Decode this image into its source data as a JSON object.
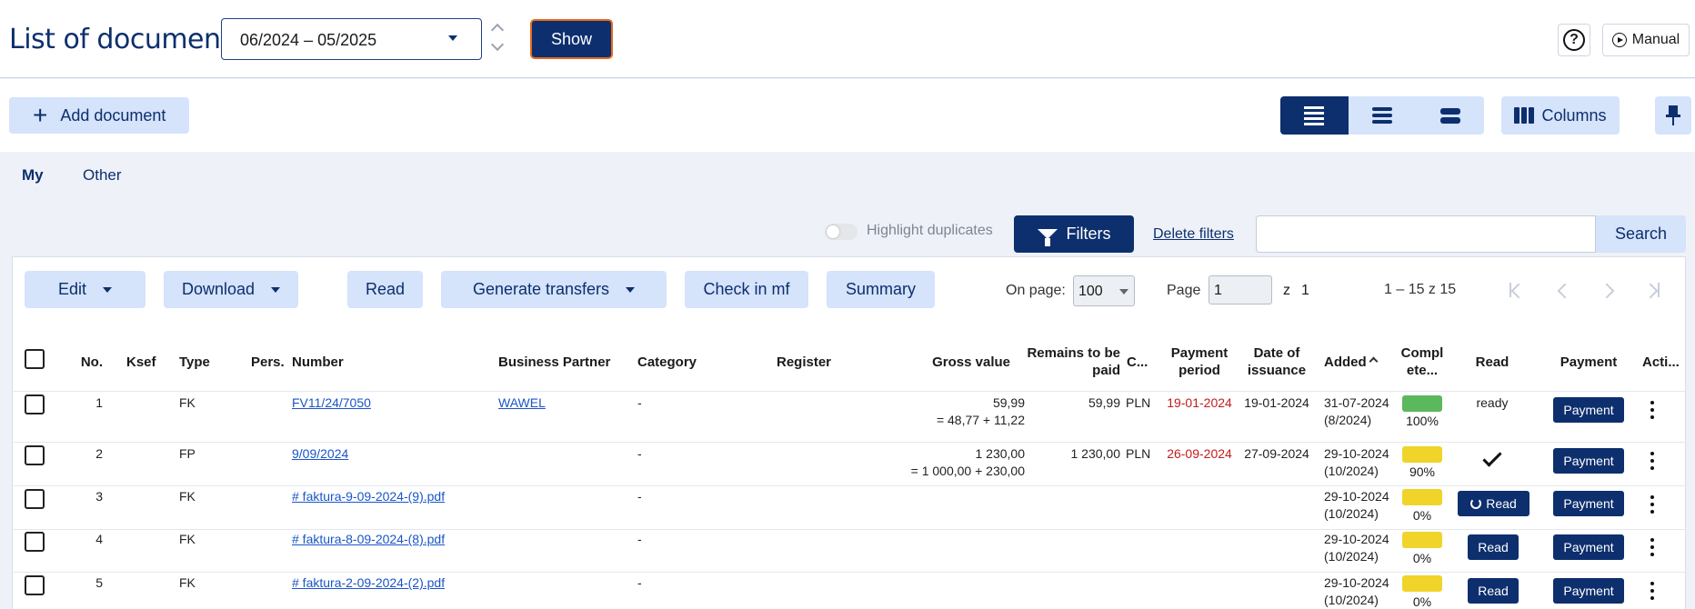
{
  "header": {
    "title": "List of documents",
    "period_value": "06/2024 – 05/2025",
    "show_label": "Show",
    "manual_label": "Manual"
  },
  "toolbar": {
    "add_document_label": "Add document",
    "columns_label": "Columns"
  },
  "tabs": [
    {
      "label": "My",
      "active": true
    },
    {
      "label": "Other",
      "active": false
    }
  ],
  "filters": {
    "highlight_duplicates_label": "Highlight duplicates",
    "highlight_duplicates_on": false,
    "filters_label": "Filters",
    "delete_filters_label": "Delete filters",
    "search_value": "",
    "search_label": "Search"
  },
  "actions": {
    "edit": "Edit",
    "download": "Download",
    "read": "Read",
    "generate_transfers": "Generate transfers",
    "check_in_mf": "Check in mf",
    "summary": "Summary"
  },
  "pagination": {
    "on_page_label": "On page:",
    "on_page_value": "100",
    "page_label": "Page",
    "page_value": "1",
    "of_label": "z",
    "total_pages": "1",
    "range_text": "1 – 15 z 15"
  },
  "columns": {
    "no": "No.",
    "ksef": "Ksef",
    "type": "Type",
    "pers": "Pers.",
    "number": "Number",
    "business_partner": "Business Partner",
    "category": "Category",
    "register": "Register",
    "gross_value": "Gross value",
    "remains_line1": "Remains to be",
    "remains_line2": "paid",
    "currency": "C...",
    "payment_period_line1": "Payment",
    "payment_period_line2": "period",
    "date_issuance_line1": "Date of",
    "date_issuance_line2": "issuance",
    "added": "Added",
    "completeness_line1": "Compl",
    "completeness_line2": "ete...",
    "read": "Read",
    "payment": "Payment",
    "actions": "Acti..."
  },
  "colors": {
    "primary": "#0d2f6e",
    "accent_light": "#d5e3fb",
    "complete_green": "#5cb85c",
    "partial_yellow": "#f0d42a",
    "overdue_red": "#c31c1c",
    "show_border": "#e86a1c"
  },
  "rows": [
    {
      "no": "1",
      "type": "FK",
      "number": "FV11/24/7050",
      "partner": "WAWEL",
      "category": "-",
      "gross": "59,99",
      "gross_breakdown": "= 48,77 + 11,22",
      "remains": "59,99",
      "currency": "PLN",
      "payment_period": "19-01-2024",
      "issuance": "19-01-2024",
      "added": "31-07-2024",
      "added_period": "(8/2024)",
      "completeness": 100,
      "completeness_label": "100%",
      "read_status": "ready",
      "payment_label": "Payment"
    },
    {
      "no": "2",
      "type": "FP",
      "number": "9/09/2024",
      "partner": "",
      "category": "-",
      "gross": "1 230,00",
      "gross_breakdown": "= 1 000,00 + 230,00",
      "remains": "1 230,00",
      "currency": "PLN",
      "payment_period": "26-09-2024",
      "issuance": "27-09-2024",
      "added": "29-10-2024",
      "added_period": "(10/2024)",
      "completeness": 90,
      "completeness_label": "90%",
      "read_status": "done",
      "payment_label": "Payment"
    },
    {
      "no": "3",
      "type": "FK",
      "number": "# faktura-9-09-2024-(9).pdf",
      "partner": "",
      "category": "-",
      "added": "29-10-2024",
      "added_period": "(10/2024)",
      "completeness": 0,
      "completeness_label": "0%",
      "read_label": "Read",
      "read_status": "retry",
      "payment_label": "Payment"
    },
    {
      "no": "4",
      "type": "FK",
      "number": "# faktura-8-09-2024-(8).pdf",
      "partner": "",
      "category": "-",
      "added": "29-10-2024",
      "added_period": "(10/2024)",
      "completeness": 0,
      "completeness_label": "0%",
      "read_label": "Read",
      "read_status": "pending",
      "payment_label": "Payment"
    },
    {
      "no": "5",
      "type": "FK",
      "number": "# faktura-2-09-2024-(2).pdf",
      "partner": "",
      "category": "-",
      "added": "29-10-2024",
      "added_period": "(10/2024)",
      "completeness": 0,
      "completeness_label": "0%",
      "read_label": "Read",
      "read_status": "pending",
      "payment_label": "Payment"
    }
  ]
}
